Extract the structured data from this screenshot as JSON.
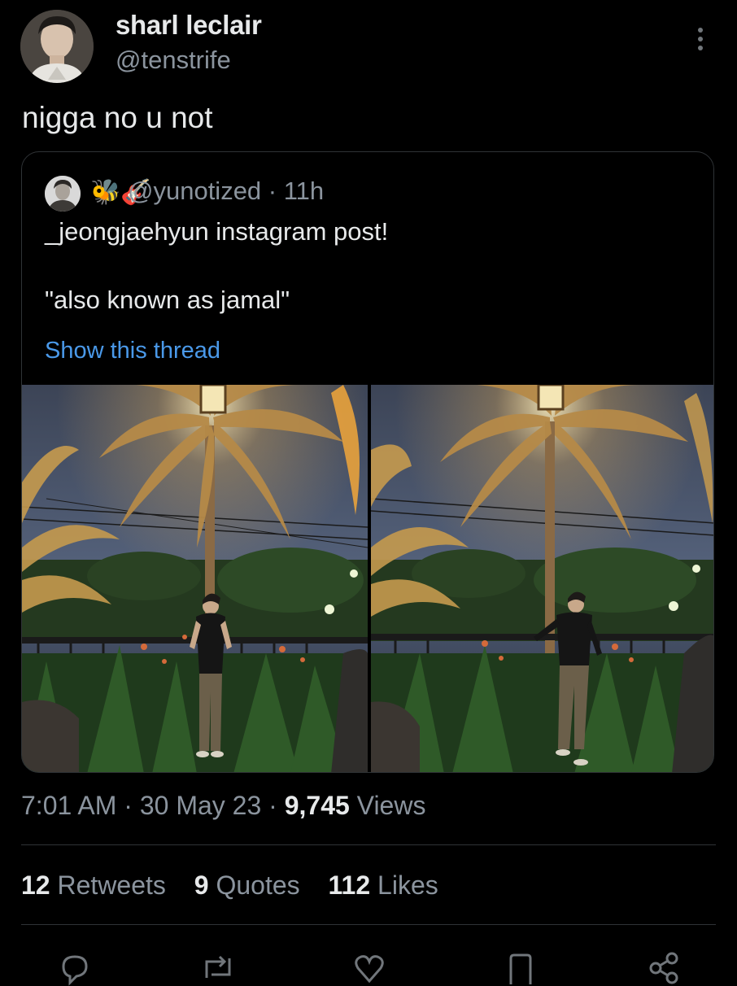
{
  "author": {
    "display_name": "sharl leclair",
    "handle": "@tenstrife"
  },
  "tweet": {
    "text": "nigga no u not"
  },
  "quoted_tweet": {
    "emoji": "🐝🎸",
    "meta": "@yunotized · 11h",
    "line1": "_jeongjaehyun instagram post!",
    "line2": "\"also known as jamal\"",
    "show_thread": "Show this thread"
  },
  "timestamp": {
    "time": "7:01 AM",
    "sep1": " · ",
    "date": "30 May 23",
    "sep2": " · ",
    "views_count": "9,745",
    "views_label": "Views"
  },
  "stats": {
    "retweets_count": "12",
    "retweets_label": "Retweets",
    "quotes_count": "9",
    "quotes_label": "Quotes",
    "likes_count": "112",
    "likes_label": "Likes"
  },
  "icons": {
    "reply": "reply-icon",
    "retweet": "retweet-icon",
    "like": "heart-icon",
    "bookmark": "bookmark-icon",
    "share": "share-icon",
    "more": "more-vertical-icon"
  },
  "colors": {
    "background": "#000000",
    "text_primary": "#e7e9ea",
    "text_secondary": "#8b949e",
    "link": "#4a99e9",
    "border": "#2f3336"
  }
}
